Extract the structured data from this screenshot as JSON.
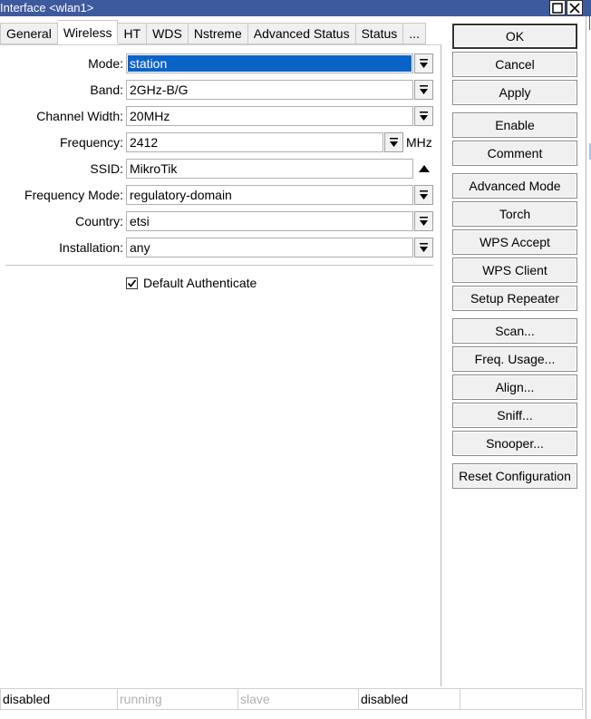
{
  "window": {
    "title": "Interface <wlan1>"
  },
  "tabs": [
    {
      "label": "General"
    },
    {
      "label": "Wireless"
    },
    {
      "label": "HT"
    },
    {
      "label": "WDS"
    },
    {
      "label": "Nstreme"
    },
    {
      "label": "Advanced Status"
    },
    {
      "label": "Status"
    },
    {
      "label": "..."
    }
  ],
  "form": {
    "mode": {
      "label": "Mode:",
      "value": "station"
    },
    "band": {
      "label": "Band:",
      "value": "2GHz-B/G"
    },
    "channel_width": {
      "label": "Channel Width:",
      "value": "20MHz"
    },
    "frequency": {
      "label": "Frequency:",
      "value": "2412",
      "unit": "MHz"
    },
    "ssid": {
      "label": "SSID:",
      "value": "MikroTik"
    },
    "frequency_mode": {
      "label": "Frequency Mode:",
      "value": "regulatory-domain"
    },
    "country": {
      "label": "Country:",
      "value": "etsi"
    },
    "installation": {
      "label": "Installation:",
      "value": "any"
    },
    "default_authenticate": {
      "label": "Default Authenticate",
      "checked": true
    }
  },
  "buttons": {
    "ok": "OK",
    "cancel": "Cancel",
    "apply": "Apply",
    "enable": "Enable",
    "comment": "Comment",
    "advanced_mode": "Advanced Mode",
    "torch": "Torch",
    "wps_accept": "WPS Accept",
    "wps_client": "WPS Client",
    "setup_repeater": "Setup Repeater",
    "scan": "Scan...",
    "freq_usage": "Freq. Usage...",
    "align": "Align...",
    "sniff": "Sniff...",
    "snooper": "Snooper...",
    "reset_configuration": "Reset Configuration"
  },
  "status": [
    {
      "text": "disabled",
      "dim": false
    },
    {
      "text": "running",
      "dim": true
    },
    {
      "text": "slave",
      "dim": true
    },
    {
      "text": "disabled",
      "dim": false
    },
    {
      "text": "",
      "dim": false
    }
  ],
  "colors": {
    "titlebar": "#3d5a9e",
    "selection": "#0a64c8"
  }
}
